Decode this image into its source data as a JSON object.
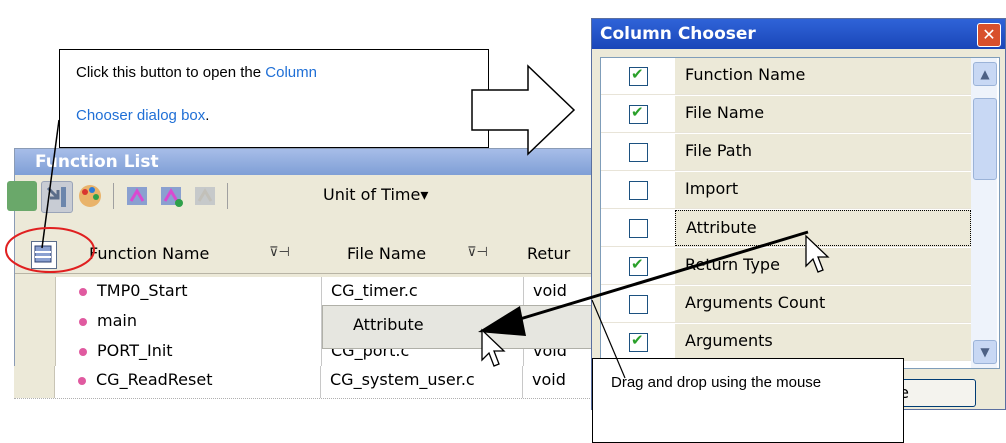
{
  "function_list": {
    "title": "Function List",
    "toolbar": {
      "unit_label": "Unit of Time",
      "unit_arrow": "▾"
    },
    "headers": {
      "function_name": "Function Name",
      "file_name": "File Name",
      "return": "Retur",
      "filter_icon": "⊽⊣"
    },
    "rows": [
      {
        "function": "TMP0_Start",
        "file": "CG_timer.c",
        "return": "void"
      },
      {
        "function": "main",
        "file": "C",
        "return": ""
      },
      {
        "function": "PORT_Init",
        "file": "CG_port.c",
        "return": "void"
      },
      {
        "function": "CG_ReadReset",
        "file": "CG_system_user.c",
        "return": "void"
      }
    ]
  },
  "column_chooser": {
    "title": "Column Chooser",
    "close_glyph": "✕",
    "items": [
      {
        "label": "Function Name",
        "checked": true
      },
      {
        "label": "File Name",
        "checked": true
      },
      {
        "label": "File Path",
        "checked": false
      },
      {
        "label": "Import",
        "checked": false
      },
      {
        "label": "Attribute",
        "checked": false,
        "selected": true
      },
      {
        "label": "Return Type",
        "checked": true
      },
      {
        "label": "Arguments Count",
        "checked": false
      },
      {
        "label": "Arguments",
        "checked": true
      }
    ],
    "close_button_partial": "ose",
    "scroll_up": "▲",
    "scroll_down": "▼"
  },
  "drag_ghost": {
    "label": "Attribute"
  },
  "callouts": {
    "button_hint": {
      "plain1": "Click this button to open the ",
      "link1": "Column",
      "link2": "Chooser dialog box",
      "plain2": "."
    },
    "drag_hint": "Drag and drop using the mouse"
  },
  "colors": {
    "accent": "#1f6fd6",
    "annotation_circle": "#e02020",
    "check": "#2aa02a",
    "title_blue": "#1a46b8"
  }
}
